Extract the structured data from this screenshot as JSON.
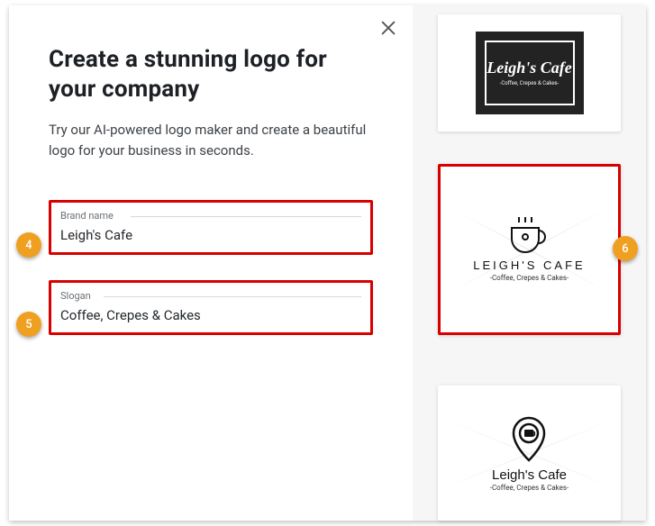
{
  "header": {
    "title": "Create a stunning logo for your company",
    "subtitle": "Try our AI-powered logo maker and create a beautiful logo for your business in seconds."
  },
  "fields": {
    "brand_label": "Brand name",
    "brand_value": "Leigh's Cafe",
    "slogan_label": "Slogan",
    "slogan_value": "Coffee, Crepes & Cakes"
  },
  "annotations": {
    "badge_brand": "4",
    "badge_slogan": "5",
    "badge_preview": "6"
  },
  "previews": {
    "logo1": {
      "brand": "Leigh's Cafe",
      "slogan": "-Coffee, Crepes & Cakes-"
    },
    "logo2": {
      "brand": "LEIGH'S CAFE",
      "slogan": "-Coffee, Crepes & Cakes-"
    },
    "logo3": {
      "brand": "Leigh's Cafe",
      "slogan": "-Coffee, Crepes & Cakes-"
    }
  },
  "colors": {
    "highlight": "#d90000",
    "badge": "#f0a020"
  }
}
